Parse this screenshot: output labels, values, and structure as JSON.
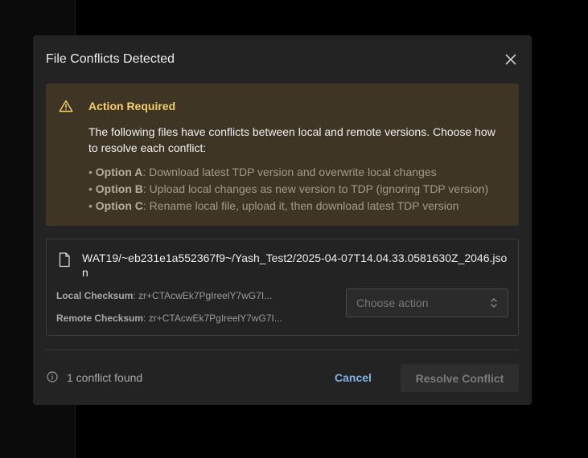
{
  "dialog": {
    "title": "File Conflicts Detected",
    "close_icon": "close-icon"
  },
  "alert": {
    "icon": "warning-triangle-icon",
    "title": "Action Required",
    "body": "The following files have conflicts between local and remote versions. Choose how to resolve each conflict:",
    "options": [
      {
        "label": "Option A",
        "text": ": Download latest TDP version and overwrite local changes"
      },
      {
        "label": "Option B",
        "text": ": Upload local changes as new version to TDP (ignoring TDP version)"
      },
      {
        "label": "Option C",
        "text": ": Rename local file, upload it, then download latest TDP version"
      }
    ]
  },
  "conflict": {
    "file_icon": "file-icon",
    "path": "WAT19/~eb231e1a552367f9~/Yash_Test2/2025-04-07T14.04.33.0581630Z_2046.json",
    "local_label": "Local Checksum",
    "local_value": ": zr+CTAcwEk7PgIreelY7wG7I...",
    "remote_label": "Remote Checksum",
    "remote_value": ": zr+CTAcwEk7PgIreelY7wG7I...",
    "action_placeholder": "Choose action"
  },
  "footer": {
    "info_icon": "info-icon",
    "count_text": "1 conflict found",
    "cancel_label": "Cancel",
    "resolve_label": "Resolve Conflict"
  },
  "colors": {
    "dialog_bg": "#232323",
    "alert_bg": "#3e3525",
    "alert_title": "#f3cf6a",
    "cancel": "#7fb2e6"
  }
}
